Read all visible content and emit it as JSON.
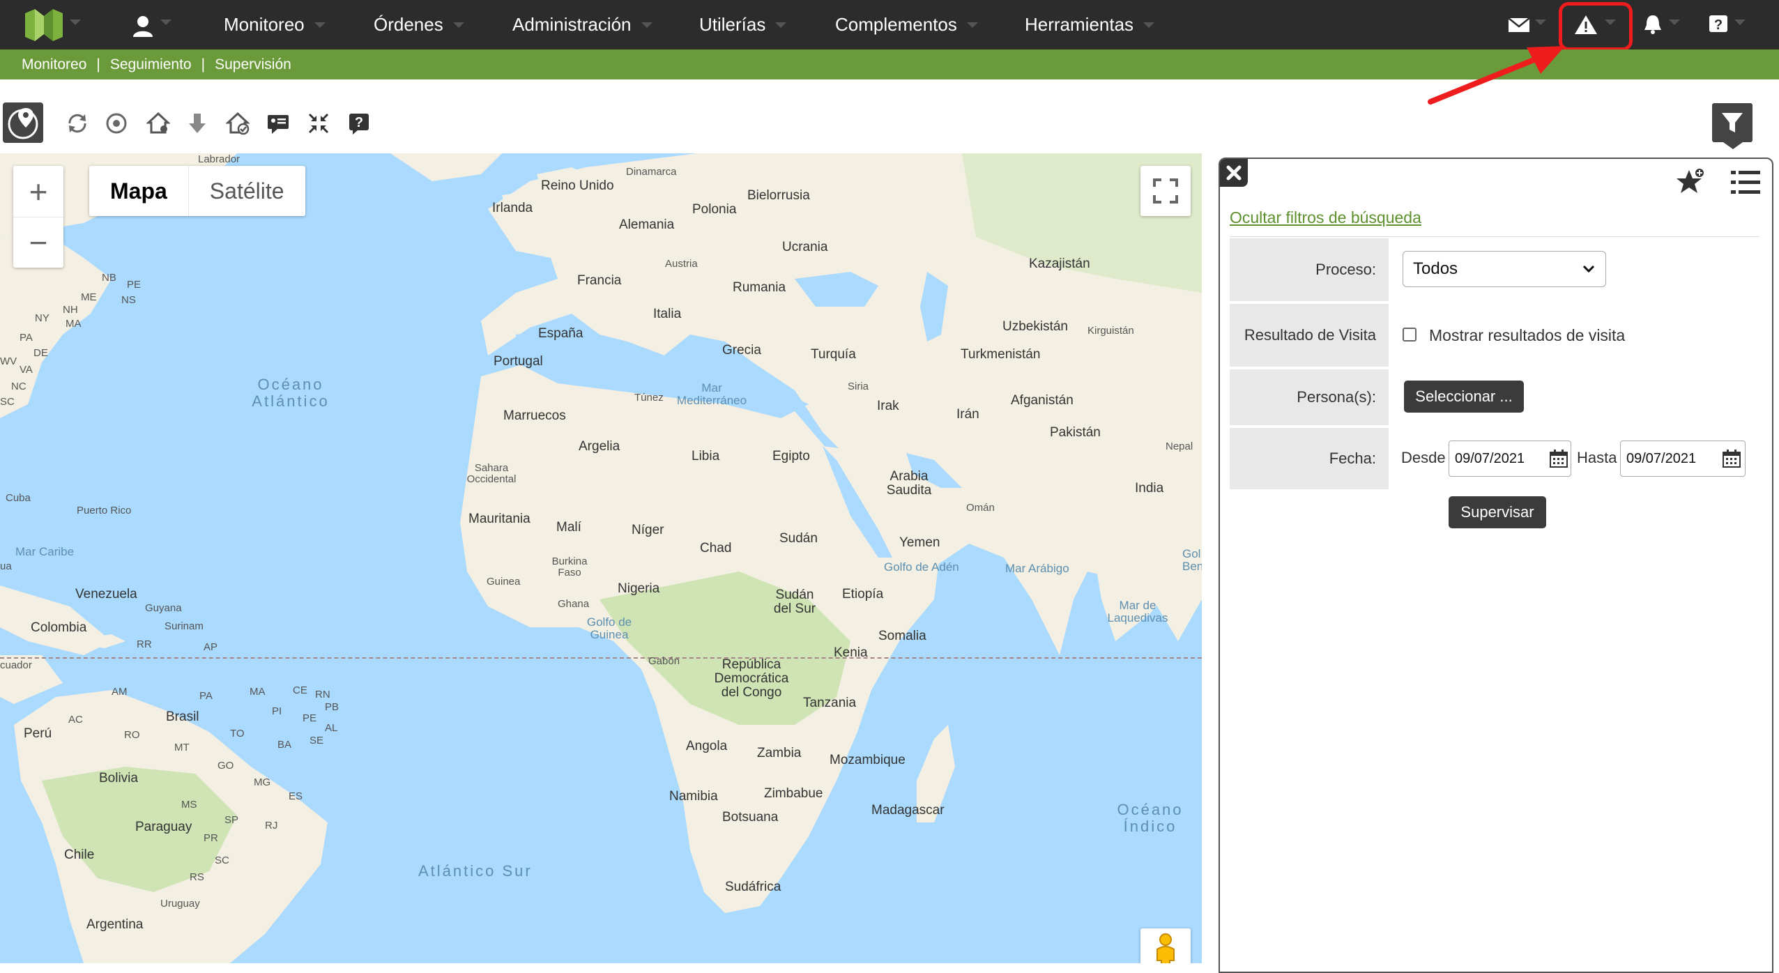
{
  "nav": {
    "menu": [
      "Monitoreo",
      "Órdenes",
      "Administración",
      "Utilerías",
      "Complementos",
      "Herramientas"
    ],
    "icons": [
      "mail-icon",
      "warning-icon",
      "bell-icon",
      "help-icon"
    ]
  },
  "breadcrumb": [
    "Monitoreo",
    "Seguimiento",
    "Supervisión"
  ],
  "breadcrumb_separator": "|",
  "map": {
    "type_active": "Mapa",
    "type_inactive": "Satélite",
    "zoom_in": "+",
    "zoom_out": "−",
    "labels": {
      "labrador": "Labrador",
      "dinamarca": "Dinamarca",
      "reino_unido": "Reino Unido",
      "bielorrusia": "Bielorrusia",
      "irlanda": "Irlanda",
      "polonia": "Polonia",
      "alemania": "Alemania",
      "ucrania": "Ucrania",
      "austria": "Austria",
      "kazajistan": "Kazajistán",
      "francia": "Francia",
      "rumania": "Rumania",
      "italia": "Italia",
      "uzbekistan": "Uzbekistán",
      "kirguistan": "Kirguistán",
      "espana": "España",
      "portugal": "Portugal",
      "grecia": "Grecia",
      "turquia": "Turquía",
      "turkmenistan": "Turkmenistán",
      "siria": "Siria",
      "afganistan": "Afganistán",
      "tunez": "Túnez",
      "mar_mediterraneo": "Mar Mediterráneo",
      "irak": "Irak",
      "iran": "Irán",
      "marruecos": "Marruecos",
      "pakistan": "Pakistán",
      "argelia": "Argelia",
      "libia": "Libia",
      "egipto": "Egipto",
      "nepal": "Nepal",
      "sahara_occidental": "Sahara Occidental",
      "arabia_saudita": "Arabia Saudita",
      "india": "India",
      "oman": "Omán",
      "mauritania": "Mauritania",
      "mali": "Malí",
      "niger": "Níger",
      "chad": "Chad",
      "sudan": "Sudán",
      "yemen": "Yemen",
      "burkina_faso": "Burkina Faso",
      "golfo_aden": "Golfo de Adén",
      "mar_arabigo": "Mar Arábigo",
      "guinea": "Guinea",
      "nigeria": "Nigeria",
      "etiopia": "Etiopía",
      "ghana": "Ghana",
      "sudan_sur": "Sudán del Sur",
      "golfo_guinea": "Golfo de Guinea",
      "mar_laquedivas": "Mar de Laquedivas",
      "somalia": "Somalia",
      "kenia": "Kenia",
      "gabon": "Gabón",
      "rdc": "República Democrática del Congo",
      "tanzania": "Tanzania",
      "angola": "Angola",
      "zambia": "Zambia",
      "mozambique": "Mozambique",
      "namibia": "Namibia",
      "zimbabue": "Zimbabue",
      "botsuana": "Botsuana",
      "madagascar": "Madagascar",
      "oceano_indico": "Océano Índico",
      "sudafrica": "Sudáfrica",
      "atlantico_sur": "Atlántico Sur",
      "oceano_atlantico": "Océano Atlántico",
      "cuba": "Cuba",
      "puerto_rico": "Puerto Rico",
      "mar_caribe": "Mar Caribe",
      "venezuela": "Venezuela",
      "guyana": "Guyana",
      "surinam": "Surinam",
      "colombia": "Colombia",
      "ecuador": "cuador",
      "peru": "Perú",
      "brasil": "Brasil",
      "bolivia": "Bolivia",
      "paraguay": "Paraguay",
      "chile": "Chile",
      "uruguay": "Uruguay",
      "argentina": "Argentina",
      "golfo_bengala": "Gol Ben",
      "nb": "NB",
      "pe": "PE",
      "ns": "NS",
      "me": "ME",
      "ny": "NY",
      "nh": "NH",
      "ma": "MA",
      "pa": "PA",
      "wv": "WV",
      "va": "VA",
      "de": "DE",
      "nc": "NC",
      "sc": "SC",
      "rr": "RR",
      "ap": "AP",
      "am": "AM",
      "pa_br": "PA",
      "ma_br": "MA",
      "ce": "CE",
      "rn": "RN",
      "pb": "PB",
      "pi": "PI",
      "pe_br": "PE",
      "ac": "AC",
      "ro": "RO",
      "to": "TO",
      "al": "AL",
      "se": "SE",
      "mt": "MT",
      "ba": "BA",
      "go": "GO",
      "mg": "MG",
      "es": "ES",
      "ms": "MS",
      "sp": "SP",
      "rj": "RJ",
      "pr": "PR",
      "sc_br": "SC",
      "rs": "RS",
      "ua": "ua"
    }
  },
  "panel": {
    "hide_filters": "Ocultar filtros de búsqueda",
    "proceso_label": "Proceso:",
    "proceso_value": "Todos",
    "resultado_label": "Resultado de Visita",
    "resultado_checkbox": "Mostrar resultados de visita",
    "persona_label": "Persona(s):",
    "persona_button": "Seleccionar ...",
    "fecha_label": "Fecha:",
    "desde_label": "Desde",
    "desde_value": "09/07/2021",
    "hasta_label": "Hasta",
    "hasta_value": "09/07/2021",
    "supervisar_button": "Supervisar"
  },
  "colors": {
    "nav_bg": "#2c2c2c",
    "breadcrumb_bg": "#6b9a3a",
    "link_green": "#5d8f2c",
    "highlight_red": "#ee1c1c",
    "water": "#aadaff",
    "land": "#f3efe2",
    "land_green": "#cfe3b4"
  }
}
